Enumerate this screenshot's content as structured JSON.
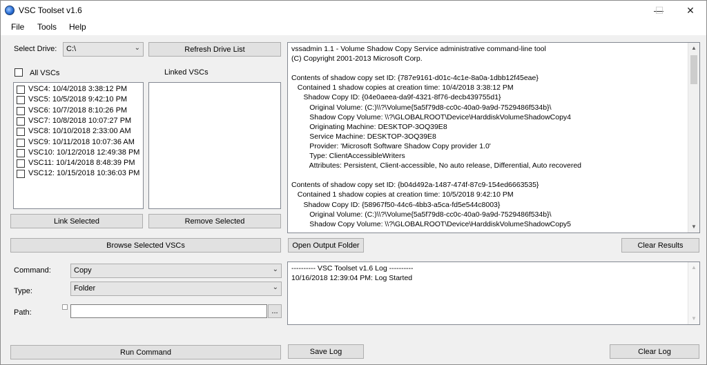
{
  "window": {
    "title": "VSC Toolset v1.6",
    "minimize": "—",
    "maximize": "☐",
    "close": "✕"
  },
  "menu": {
    "file": "File",
    "tools": "Tools",
    "help": "Help"
  },
  "drive": {
    "label": "Select Drive:",
    "value": "C:\\",
    "refresh_label": "Refresh Drive List"
  },
  "vsc": {
    "all_label": "All VSCs",
    "linked_label": "Linked VSCs",
    "items": [
      "VSC4: 10/4/2018 3:38:12 PM",
      "VSC5: 10/5/2018 9:42:10 PM",
      "VSC6: 10/7/2018 8:10:26 PM",
      "VSC7: 10/8/2018 10:07:27 PM",
      "VSC8: 10/10/2018 2:33:00 AM",
      "VSC9: 10/11/2018 10:07:36 AM",
      "VSC10: 10/12/2018 12:49:38 PM",
      "VSC11: 10/14/2018 8:48:39 PM",
      "VSC12: 10/15/2018 10:36:03 PM"
    ],
    "link_selected": "Link Selected",
    "remove_selected": "Remove Selected",
    "browse_selected": "Browse Selected VSCs"
  },
  "output": {
    "text": "vssadmin 1.1 - Volume Shadow Copy Service administrative command-line tool\n(C) Copyright 2001-2013 Microsoft Corp.\n\nContents of shadow copy set ID: {787e9161-d01c-4c1e-8a0a-1dbb12f45eae}\n   Contained 1 shadow copies at creation time: 10/4/2018 3:38:12 PM\n      Shadow Copy ID: {04e0aeea-da9f-4321-8f76-decb439755d1}\n         Original Volume: (C:)\\\\?\\Volume{5a5f79d8-cc0c-40a0-9a9d-7529486f534b}\\\n         Shadow Copy Volume: \\\\?\\GLOBALROOT\\Device\\HarddiskVolumeShadowCopy4\n         Originating Machine: DESKTOP-3OQ39E8\n         Service Machine: DESKTOP-3OQ39E8\n         Provider: 'Microsoft Software Shadow Copy provider 1.0'\n         Type: ClientAccessibleWriters\n         Attributes: Persistent, Client-accessible, No auto release, Differential, Auto recovered\n\nContents of shadow copy set ID: {b04d492a-1487-474f-87c9-154ed6663535}\n   Contained 1 shadow copies at creation time: 10/5/2018 9:42:10 PM\n      Shadow Copy ID: {58967f50-44c6-4bb3-a5ca-fd5e544c8003}\n         Original Volume: (C:)\\\\?\\Volume{5a5f79d8-cc0c-40a0-9a9d-7529486f534b}\\\n         Shadow Copy Volume: \\\\?\\GLOBALROOT\\Device\\HarddiskVolumeShadowCopy5",
    "open_folder": "Open Output Folder",
    "clear_results": "Clear Results"
  },
  "command": {
    "command_label": "Command:",
    "command_value": "Copy",
    "type_label": "Type:",
    "type_value": "Folder",
    "path_label": "Path:",
    "path_value": "",
    "browse_btn": "...",
    "run_label": "Run Command"
  },
  "log": {
    "text": "---------- VSC Toolset v1.6 Log ----------\n10/16/2018 12:39:04 PM: Log Started",
    "save": "Save Log",
    "clear": "Clear Log"
  }
}
